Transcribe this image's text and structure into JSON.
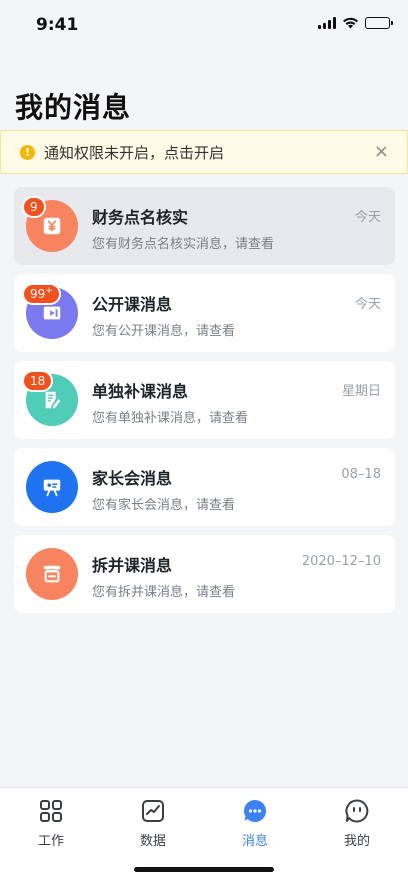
{
  "status": {
    "time": "9:41"
  },
  "page": {
    "title": "我的消息"
  },
  "notice": {
    "text": "通知权限未开启，点击开启",
    "close": "×",
    "icon": "!"
  },
  "messages": [
    {
      "title": "财务点名核实",
      "subtitle": "您有财务点名核实消息，请查看",
      "date": "今天",
      "badge": "9",
      "color": "#f7845e",
      "icon": "yen-icon"
    },
    {
      "title": "公开课消息",
      "subtitle": "您有公开课消息，请查看",
      "date": "今天",
      "badge": "99",
      "badge_sup": "+",
      "color": "#7b79f0",
      "icon": "video-icon"
    },
    {
      "title": "单独补课消息",
      "subtitle": "您有单独补课消息，请查看",
      "date": "星期日",
      "badge": "18",
      "color": "#4fcdb9",
      "icon": "edit-doc-icon"
    },
    {
      "title": "家长会消息",
      "subtitle": "您有家长会消息，请查看",
      "date": "08–18",
      "badge": "",
      "color": "#1e73f0",
      "icon": "presentation-icon"
    },
    {
      "title": "拆并课消息",
      "subtitle": "您有拆并课消息，请查看",
      "date": "2020–12–10",
      "badge": "",
      "color": "#f7845e",
      "icon": "merge-icon"
    }
  ],
  "tabs": [
    {
      "label": "工作",
      "icon": "grid-icon",
      "active": false
    },
    {
      "label": "数据",
      "icon": "chart-icon",
      "active": false
    },
    {
      "label": "消息",
      "icon": "message-icon",
      "active": true
    },
    {
      "label": "我的",
      "icon": "profile-icon",
      "active": false
    }
  ],
  "colors": {
    "accent": "#3b82f6",
    "badge": "#f2501d",
    "notice_bg": "#fffbe6"
  }
}
